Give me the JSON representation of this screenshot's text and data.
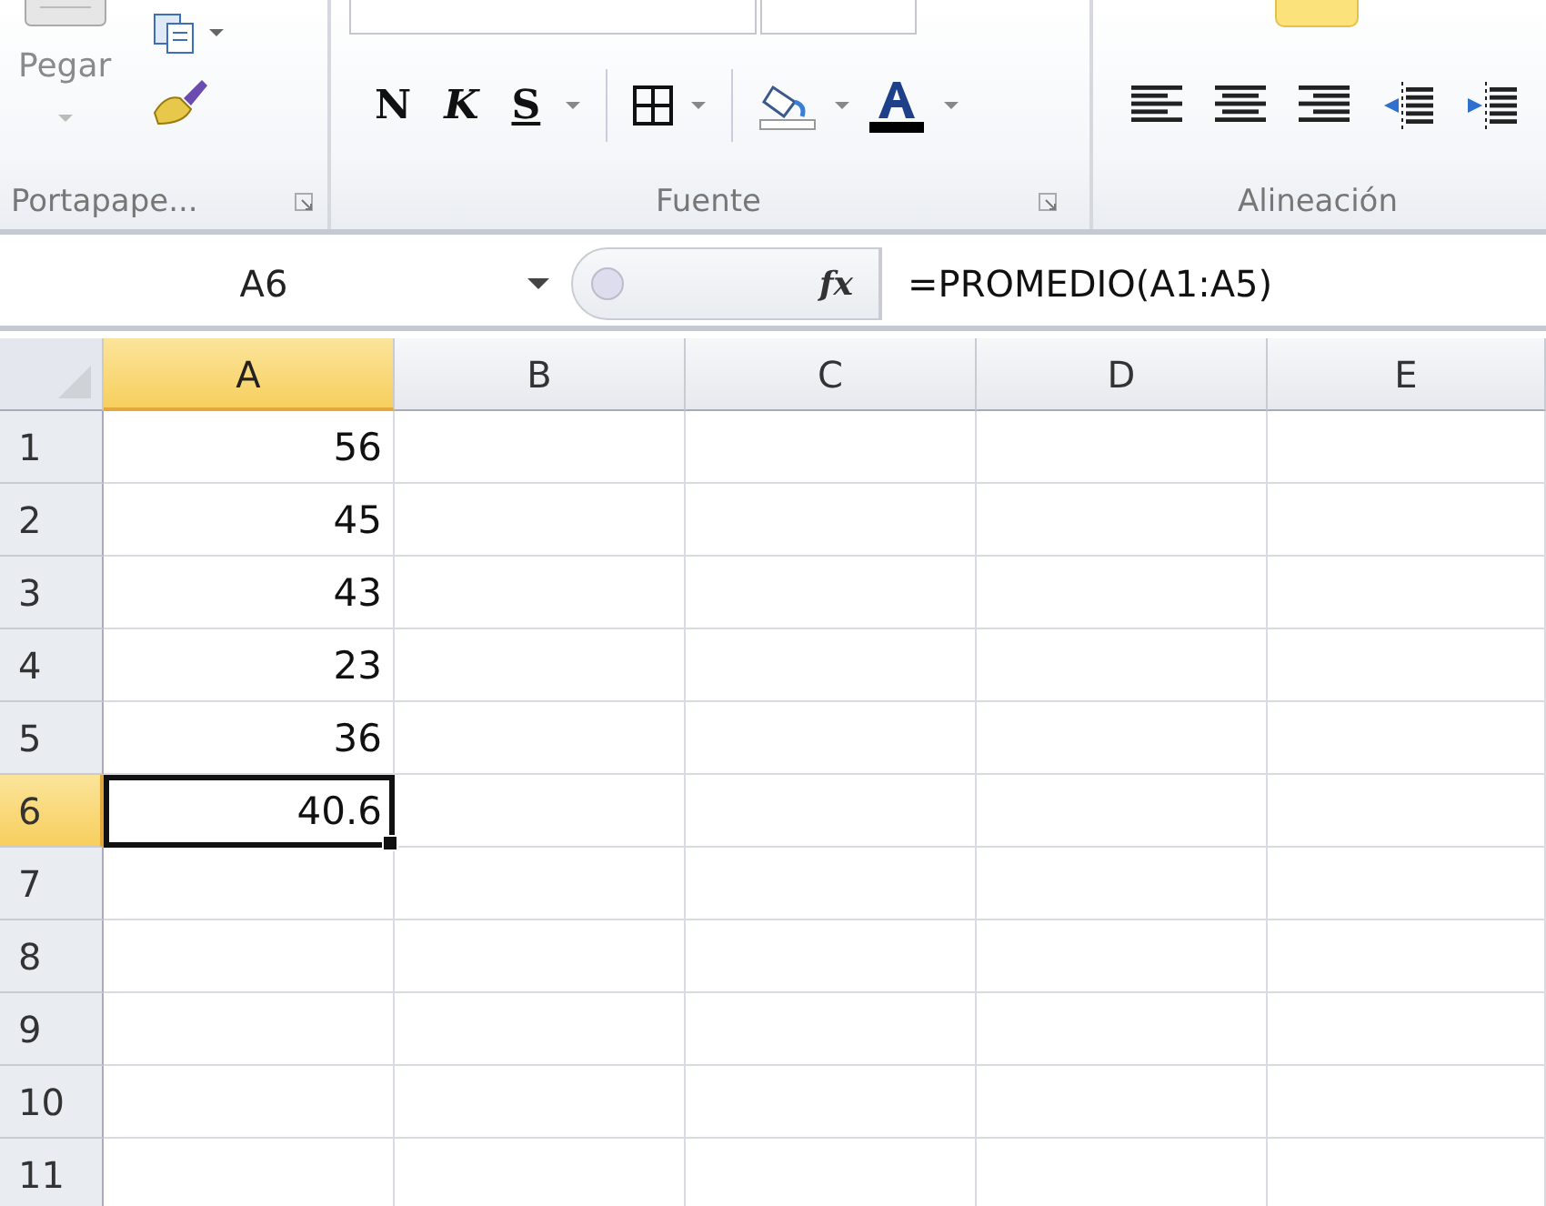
{
  "ribbon": {
    "groups": [
      {
        "kind": "clipboard",
        "label": "Portapape...",
        "paste_label": "Pegar"
      },
      {
        "kind": "font",
        "label": "Fuente",
        "bold": "N",
        "italic": "K",
        "underline": "S"
      },
      {
        "kind": "alignment",
        "label": "Alineación"
      }
    ]
  },
  "formula_bar": {
    "name_box": "A6",
    "fx": "fx",
    "formula": "=PROMEDIO(A1:A5)"
  },
  "sheet": {
    "columns": [
      {
        "label": "A",
        "selected": true
      },
      {
        "label": "B",
        "selected": false
      },
      {
        "label": "C",
        "selected": false
      },
      {
        "label": "D",
        "selected": false
      },
      {
        "label": "E",
        "selected": false
      }
    ],
    "rows": [
      {
        "label": "1",
        "selected": false,
        "cells": [
          {
            "value": "56",
            "active": false
          }
        ]
      },
      {
        "label": "2",
        "selected": false,
        "cells": [
          {
            "value": "45",
            "active": false
          }
        ]
      },
      {
        "label": "3",
        "selected": false,
        "cells": [
          {
            "value": "43",
            "active": false
          }
        ]
      },
      {
        "label": "4",
        "selected": false,
        "cells": [
          {
            "value": "23",
            "active": false
          }
        ]
      },
      {
        "label": "5",
        "selected": false,
        "cells": [
          {
            "value": "36",
            "active": false
          }
        ]
      },
      {
        "label": "6",
        "selected": true,
        "cells": [
          {
            "value": "40.6",
            "active": true
          }
        ]
      },
      {
        "label": "7",
        "selected": false
      },
      {
        "label": "8",
        "selected": false
      },
      {
        "label": "9",
        "selected": false
      },
      {
        "label": "10",
        "selected": false
      },
      {
        "label": "11",
        "selected": false
      }
    ]
  }
}
